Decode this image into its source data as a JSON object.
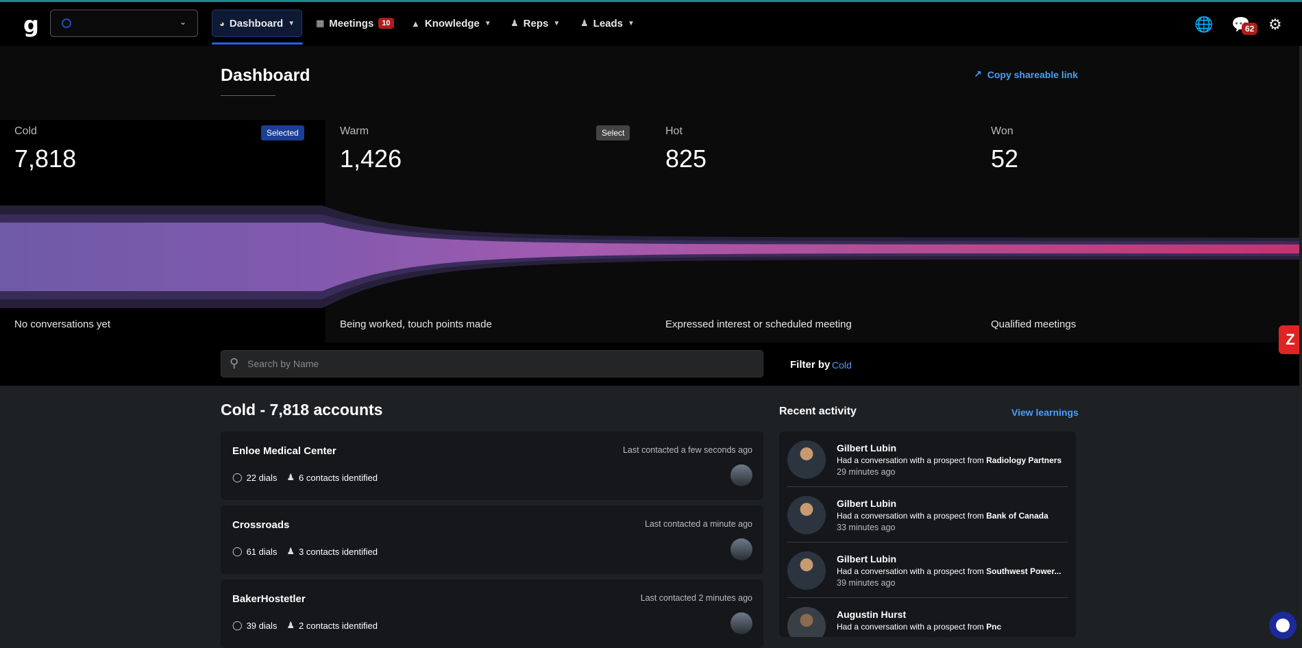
{
  "nav": {
    "logo": "g",
    "items": [
      {
        "label": "Dashboard",
        "icon": "gauge-icon"
      },
      {
        "label": "Meetings",
        "icon": "calendar-icon",
        "badge": "10"
      },
      {
        "label": "Knowledge",
        "icon": "graduation-cap-icon"
      },
      {
        "label": "Reps",
        "icon": "user-tie-icon"
      },
      {
        "label": "Leads",
        "icon": "users-icon"
      }
    ],
    "chat_badge": "62"
  },
  "page": {
    "title": "Dashboard",
    "copy_link": "Copy shareable link"
  },
  "funnel": {
    "stages": [
      {
        "label": "Cold",
        "value": "7,818",
        "desc": "No conversations yet",
        "badge": "Selected"
      },
      {
        "label": "Warm",
        "value": "1,426",
        "desc": "Being worked, touch points made",
        "badge": "Select"
      },
      {
        "label": "Hot",
        "value": "825",
        "desc": "Expressed interest or scheduled meeting"
      },
      {
        "label": "Won",
        "value": "52",
        "desc": "Qualified meetings"
      }
    ],
    "colors": {
      "start": "#7a5fb0",
      "mid": "#a45bb0",
      "end": "#c9306e"
    }
  },
  "search": {
    "placeholder": "Search by Name"
  },
  "filter": {
    "label": "Filter by",
    "value": "Cold"
  },
  "list": {
    "title": "Cold - 7,818 accounts",
    "accounts": [
      {
        "name": "Enloe Medical Center",
        "last": "Last contacted a few seconds ago",
        "dials": "22 dials",
        "contacts": "6 contacts identified"
      },
      {
        "name": "Crossroads",
        "last": "Last contacted a minute ago",
        "dials": "61 dials",
        "contacts": "3 contacts identified"
      },
      {
        "name": "BakerHostetler",
        "last": "Last contacted 2 minutes ago",
        "dials": "39 dials",
        "contacts": "2 contacts identified"
      }
    ]
  },
  "activity": {
    "title": "Recent activity",
    "view_learnings": "View learnings",
    "prefix": "Had a conversation with a prospect from ",
    "items": [
      {
        "name": "Gilbert Lubin",
        "org": "Radiology Partners",
        "time": "29 minutes ago"
      },
      {
        "name": "Gilbert Lubin",
        "org": "Bank of Canada",
        "time": "33 minutes ago"
      },
      {
        "name": "Gilbert Lubin",
        "org": "Southwest Power...",
        "time": "39 minutes ago"
      },
      {
        "name": "Augustin Hurst",
        "org": "Pnc",
        "time": ""
      }
    ]
  }
}
